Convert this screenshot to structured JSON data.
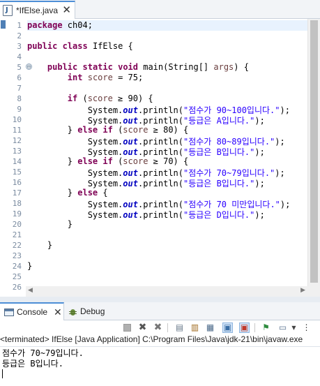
{
  "editor_tab": {
    "title": "*IfElse.java",
    "close": "✕"
  },
  "editor": {
    "line_numbers": [
      "1",
      "2",
      "3",
      "4",
      "5",
      "6",
      "7",
      "8",
      "9",
      "10",
      "11",
      "12",
      "13",
      "14",
      "15",
      "16",
      "17",
      "18",
      "19",
      "20",
      "21",
      "22",
      "23",
      "24",
      "25",
      "26"
    ],
    "fold_marker": "⊖",
    "lines": [
      [
        {
          "t": "package",
          "c": "kw"
        },
        {
          "t": " ch04;"
        }
      ],
      [],
      [
        {
          "t": "public",
          "c": "kw"
        },
        {
          "t": " "
        },
        {
          "t": "class",
          "c": "kw"
        },
        {
          "t": " IfElse {"
        }
      ],
      [],
      [
        {
          "t": "    "
        },
        {
          "t": "public",
          "c": "kw"
        },
        {
          "t": " "
        },
        {
          "t": "static",
          "c": "kw"
        },
        {
          "t": " "
        },
        {
          "t": "void",
          "c": "kw"
        },
        {
          "t": " main(String[] "
        },
        {
          "t": "args",
          "c": "var"
        },
        {
          "t": ") {"
        }
      ],
      [
        {
          "t": "        "
        },
        {
          "t": "int",
          "c": "kw"
        },
        {
          "t": " "
        },
        {
          "t": "score",
          "c": "var"
        },
        {
          "t": " = 75;"
        }
      ],
      [],
      [
        {
          "t": "        "
        },
        {
          "t": "if",
          "c": "kw"
        },
        {
          "t": " ("
        },
        {
          "t": "score",
          "c": "var"
        },
        {
          "t": " ≥ 90) {"
        }
      ],
      [
        {
          "t": "            System."
        },
        {
          "t": "out",
          "c": "fld"
        },
        {
          "t": ".println("
        },
        {
          "t": "\"점수가 90~100입니다.\"",
          "c": "str"
        },
        {
          "t": ");"
        }
      ],
      [
        {
          "t": "            System."
        },
        {
          "t": "out",
          "c": "fld"
        },
        {
          "t": ".println("
        },
        {
          "t": "\"등급은 A입니다.\"",
          "c": "str"
        },
        {
          "t": ");"
        }
      ],
      [
        {
          "t": "        } "
        },
        {
          "t": "else",
          "c": "kw"
        },
        {
          "t": " "
        },
        {
          "t": "if",
          "c": "kw"
        },
        {
          "t": " ("
        },
        {
          "t": "score",
          "c": "var"
        },
        {
          "t": " ≥ 80) {"
        }
      ],
      [
        {
          "t": "            System."
        },
        {
          "t": "out",
          "c": "fld"
        },
        {
          "t": ".println("
        },
        {
          "t": "\"점수가 80~89입니다.\"",
          "c": "str"
        },
        {
          "t": ");"
        }
      ],
      [
        {
          "t": "            System."
        },
        {
          "t": "out",
          "c": "fld"
        },
        {
          "t": ".println("
        },
        {
          "t": "\"등급은 B입니다.\"",
          "c": "str"
        },
        {
          "t": ");"
        }
      ],
      [
        {
          "t": "        } "
        },
        {
          "t": "else",
          "c": "kw"
        },
        {
          "t": " "
        },
        {
          "t": "if",
          "c": "kw"
        },
        {
          "t": " ("
        },
        {
          "t": "score",
          "c": "var"
        },
        {
          "t": " ≥ 70) {"
        }
      ],
      [
        {
          "t": "            System."
        },
        {
          "t": "out",
          "c": "fld"
        },
        {
          "t": ".println("
        },
        {
          "t": "\"점수가 70~79입니다.\"",
          "c": "str"
        },
        {
          "t": ");"
        }
      ],
      [
        {
          "t": "            System."
        },
        {
          "t": "out",
          "c": "fld"
        },
        {
          "t": ".println("
        },
        {
          "t": "\"등급은 B입니다.\"",
          "c": "str"
        },
        {
          "t": ");"
        }
      ],
      [
        {
          "t": "        } "
        },
        {
          "t": "else",
          "c": "kw"
        },
        {
          "t": " {"
        }
      ],
      [
        {
          "t": "            System."
        },
        {
          "t": "out",
          "c": "fld"
        },
        {
          "t": ".println("
        },
        {
          "t": "\"점수가 70 미만입니다.\"",
          "c": "str"
        },
        {
          "t": ");"
        }
      ],
      [
        {
          "t": "            System."
        },
        {
          "t": "out",
          "c": "fld"
        },
        {
          "t": ".println("
        },
        {
          "t": "\"등급은 D입니다.\"",
          "c": "str"
        },
        {
          "t": ");"
        }
      ],
      [
        {
          "t": "        }"
        }
      ],
      [],
      [
        {
          "t": "    }"
        }
      ],
      [],
      [
        {
          "t": "}"
        }
      ],
      [],
      []
    ]
  },
  "panel": {
    "tabs": [
      {
        "label": "Console",
        "close": "✕"
      },
      {
        "label": "Debug"
      }
    ],
    "console_header": "<terminated> IfElse [Java Application] C:\\Program Files\\Java\\jdk-21\\bin\\javaw.exe",
    "output": [
      "점수가 70~79입니다.",
      "등급은 B입니다."
    ]
  },
  "colors": {
    "keyword": "#7f0055",
    "string": "#2a00ff",
    "field": "#0000c0",
    "local_variable": "#6a3e3e",
    "line_number": "#7a8ba0",
    "current_line": "#e8f2fe",
    "tab_accent": "#4d8ed6"
  },
  "icons": {
    "editor_tab": "java-file-icon",
    "console_tab": "console-icon",
    "debug_tab": "debug-icon",
    "toolbar": [
      "terminate-icon",
      "remove-launch-icon",
      "remove-all-terminated-icon",
      "clear-console-icon",
      "scroll-lock-icon",
      "word-wrap-icon",
      "show-on-stdout-icon",
      "show-on-stderr-icon",
      "pin-console-icon",
      "display-console-icon",
      "view-menu-icon"
    ]
  }
}
